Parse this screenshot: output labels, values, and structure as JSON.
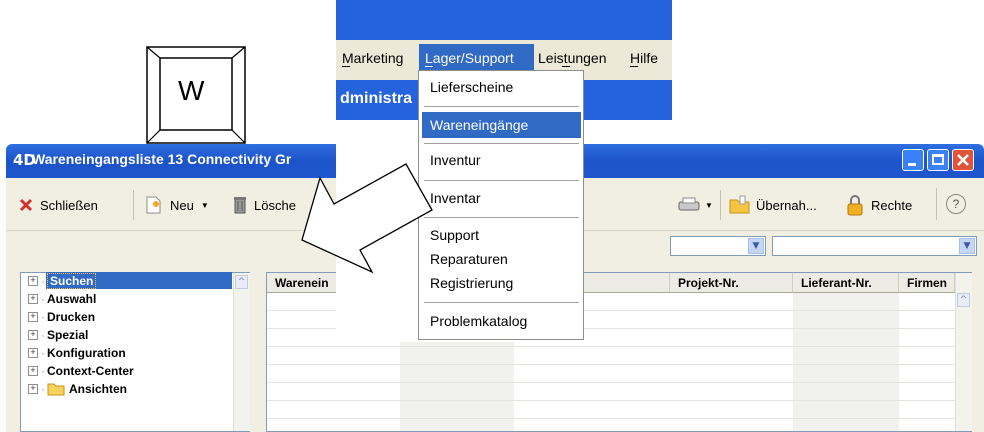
{
  "key": {
    "label": "W"
  },
  "window": {
    "title_logo": "4D",
    "title": "Wareneingangsliste 13  Connectivity Gr",
    "toolbar": {
      "close_label": "Schließen",
      "new_label": "Neu",
      "delete_label": "Lösche",
      "take_over_label": "Übernah...",
      "rights_label": "Rechte",
      "help_icon": "?"
    },
    "tree": {
      "items": [
        "Suchen",
        "Auswahl",
        "Drucken",
        "Spezial",
        "Konfiguration",
        "Context-Center",
        "Ansichten"
      ]
    },
    "grid": {
      "columns": [
        "Warenein",
        "Projekt-Nr.",
        "Lieferant-Nr.",
        "Firmen"
      ]
    }
  },
  "menubar": {
    "items": [
      "Marketing",
      "Lager/Support",
      "Leistungen",
      "Hilfe"
    ],
    "admin_text": "dministra"
  },
  "dropdown": {
    "items": [
      "Lieferscheine",
      "Wareneingänge",
      "Inventur",
      "Inventar",
      "Support",
      "Reparaturen",
      "Registrierung",
      "Problemkatalog"
    ]
  },
  "colors": {
    "xp_blue": "#2563dc",
    "selection": "#316ac5",
    "face": "#ece9d8"
  }
}
